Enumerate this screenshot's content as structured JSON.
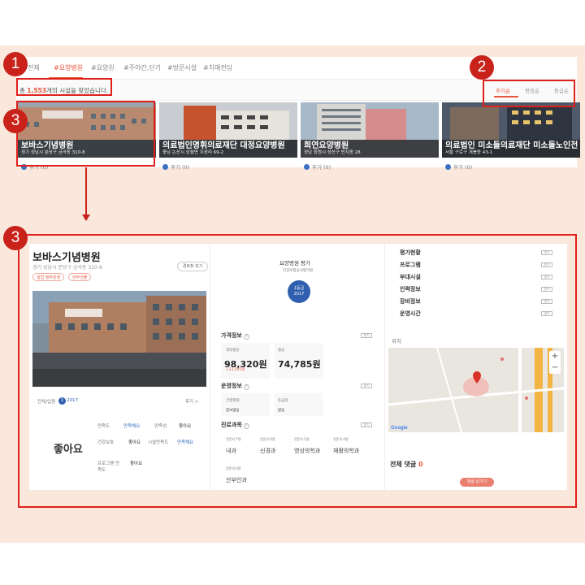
{
  "annotations": {
    "b1": "1",
    "b2": "2",
    "b3": "3",
    "b3b": "3"
  },
  "tabs": [
    "전체",
    "#요양병원",
    "#요양원",
    "#주야간,단기",
    "#방문시설",
    "#치매전담"
  ],
  "result": {
    "prefix": "총 ",
    "count": "1,553",
    "suffix": "개의 시설을 찾았습니다."
  },
  "sort": [
    "후기순",
    "평점순",
    "등급순"
  ],
  "cards": [
    {
      "name": "보바스기념병원",
      "address": "경기 성남시 분당구 금곡동 310-8",
      "review": "후기 (0)"
    },
    {
      "name": "의료법인명휘의료재단 대정요양병원",
      "address": "충남 논산시 상월면 지경리 69-2",
      "review": "후기 (0)"
    },
    {
      "name": "희연요양병원",
      "address": "경남 창원시 성산구 반지동 28",
      "review": "후기 (0)"
    },
    {
      "name": "의료법인 미소들의료재단 미소들노인전",
      "address": "서울 구로구 개봉동 43-1",
      "review": "후기 (0)"
    }
  ],
  "detail": {
    "name": "보바스기념병원",
    "address": "경기 성남시 분당구 금곡동 310-8",
    "chips": [
      "설립 정부운영",
      "안부건물"
    ],
    "route_btn": "경로찾 보기",
    "review_label": "전체/입원",
    "review_count": "1",
    "review_count2": "2017",
    "review_more": "후기 >",
    "overall": "좋아요",
    "ratings": [
      {
        "k": "만족도",
        "v": "만족해요"
      },
      {
        "k": "만족성",
        "v": "좋아요"
      },
      {
        "k": "건강보호",
        "v": "좋아요"
      },
      {
        "k": "시설만족도",
        "v": "만족해요"
      },
      {
        "k": "프로그램 만족도",
        "v": "좋아요"
      }
    ],
    "eval_title": "요양병원 평가",
    "eval_sub": "건강보험심사평가원",
    "grade": "1등급",
    "grade_year": "2017",
    "price_title": "가격정보",
    "price_labels": [
      "최대평균",
      "평균"
    ],
    "price_max": "98,320원",
    "price_diff": "+23,535원",
    "price_avg": "74,785원",
    "op_title": "운영정보",
    "op_items": [
      "간병형태",
      "등급일",
      "정보없음",
      "없음"
    ],
    "dept_title": "진료과목",
    "depts": [
      {
        "cnt": "전문의 7명",
        "name": "내과"
      },
      {
        "cnt": "전문의 0명",
        "name": "신경과"
      },
      {
        "cnt": "전문의 1명",
        "name": "영상의학과"
      },
      {
        "cnt": "전문의 4명",
        "name": "재활의학과"
      },
      {
        "cnt": "전문의 0명",
        "name": "산부인과"
      }
    ],
    "more": "열기",
    "menu": [
      "평가현황",
      "프로그램",
      "부대시설",
      "인력정보",
      "장비정보",
      "운영시간"
    ],
    "location": "위치",
    "comments": "전체 댓글",
    "comment_count": "0",
    "comment_btn": "댓글 남기기",
    "google": "Google"
  }
}
